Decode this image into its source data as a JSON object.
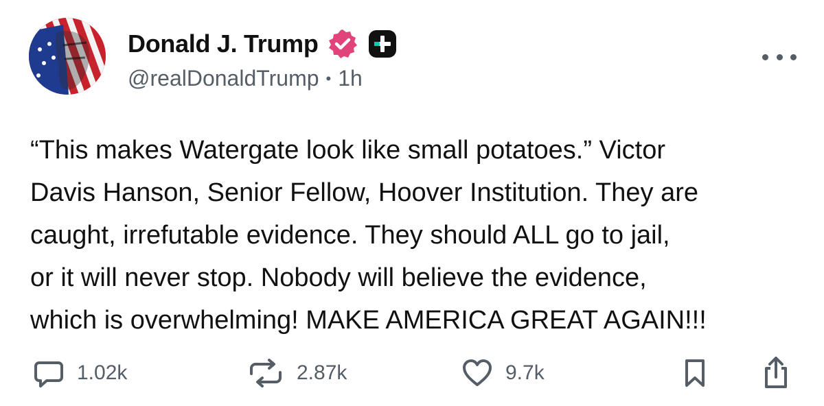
{
  "author": {
    "display_name": "Donald J. Trump",
    "handle": "@realDonaldTrump",
    "separator": "•",
    "timestamp": "1h",
    "badges": [
      "verified-icon",
      "plus-badge-icon"
    ]
  },
  "post": {
    "text": "“This makes Watergate look like small potatoes.” Victor\nDavis Hanson, Senior Fellow, Hoover Institution. They are\ncaught, irrefutable evidence. They should ALL go to jail,\nor it will never stop. Nobody will believe the evidence,\nwhich is overwhelming! MAKE AMERICA GREAT AGAIN!!!"
  },
  "actions": {
    "replies": "1.02k",
    "reposts": "2.87k",
    "likes": "9.7k",
    "icons": [
      "reply-icon",
      "repost-icon",
      "heart-icon",
      "bookmark-icon",
      "share-icon"
    ]
  },
  "colors": {
    "verified": "#e0447a",
    "secondary_text": "#555d66",
    "plus_badge_bg": "#111111",
    "plus_badge_accent": "#16c9b0"
  }
}
